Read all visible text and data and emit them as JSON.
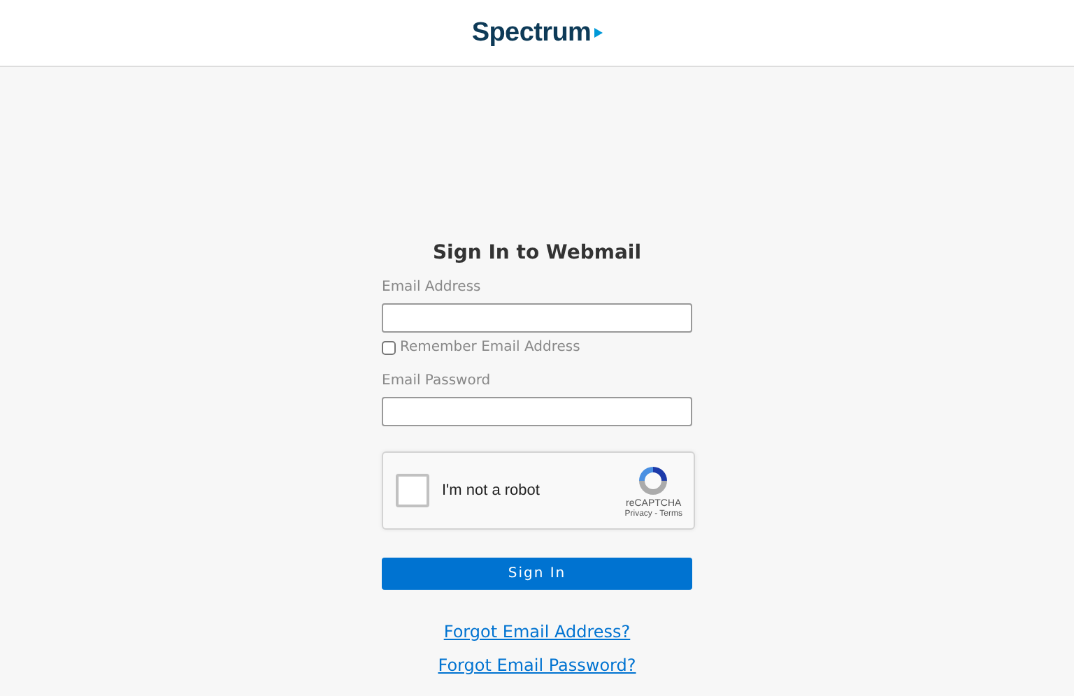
{
  "header": {
    "logo": "Spectrum"
  },
  "form": {
    "title": "Sign In to Webmail",
    "email": {
      "label": "Email Address"
    },
    "remember": {
      "label": "Remember Email Address",
      "checked": false
    },
    "password": {
      "label": "Email Password"
    },
    "captcha": {
      "label": "I'm not a robot",
      "checked": false,
      "brand": "reCAPTCHA",
      "links": "Privacy - Terms"
    },
    "submit": "Sign In",
    "links": [
      "Forgot Email Address?",
      "Forgot Email Password?"
    ]
  }
}
